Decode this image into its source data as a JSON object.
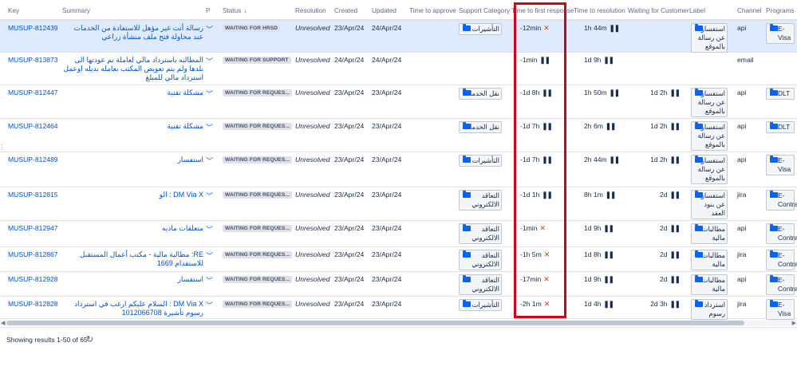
{
  "headers": {
    "key": "Key",
    "summary": "Summary",
    "p": "P",
    "status": "Status",
    "status_sort": "↓",
    "resolution": "Resolution",
    "created": "Created",
    "updated": "Updated",
    "time_to_approve": "Time to approve",
    "support_category": "Support Category",
    "time_to_first_response": "Time to first response",
    "time_to_resolution": "Time to resolution",
    "waiting_for_customer": "Waiting for Customer",
    "label": "Label",
    "channel": "Channel",
    "programs": "Programs"
  },
  "rows": [
    {
      "key": "MUSUP-812439",
      "summary": "رسالة أنت غير مؤهل للاستفادة من الخدمات عند محاولة فتح ملف منشأة زراعي",
      "status": "WAITING FOR HRSD",
      "resolution": "Unresolved",
      "created": "23/Apr/24",
      "updated": "24/Apr/24",
      "category": "التأشيرات",
      "ttfr": "-12min",
      "ttfr_breached": true,
      "ttr": "1h 44m",
      "ttr_paused": true,
      "wfc": "",
      "wfc_paused": false,
      "label": "استفسار عن رسالة بالموقع",
      "channel": "api",
      "program": "E-Visa"
    },
    {
      "key": "MUSUP-813873",
      "summary": "المطالبه باسترداد مالي لعاملة تم عودتها الى بلدها ولم يتم تعويض المكتب بعامله بديله اوعمل استرداد مالي للمبلغ",
      "status": "WAITING FOR SUPPORT",
      "resolution": "Unresolved",
      "created": "24/Apr/24",
      "updated": "24/Apr/24",
      "category": "",
      "ttfr": "-1min",
      "ttfr_breached": false,
      "ttr": "1d 9h",
      "ttr_paused": true,
      "wfc": "",
      "wfc_paused": false,
      "label": "",
      "channel": "email",
      "program": ""
    },
    {
      "key": "MUSUP-812447",
      "summary": "مشكلة تقنية",
      "status": "WAITING FOR REQUES...",
      "resolution": "Unresolved",
      "created": "23/Apr/24",
      "updated": "23/Apr/24",
      "category": "نقل الخدمات",
      "ttfr": "-1d 8h",
      "ttfr_breached": false,
      "ttr": "1h 50m",
      "ttr_paused": true,
      "wfc": "1d 2h",
      "wfc_paused": true,
      "label": "استفسار عن رسالة بالموقع",
      "channel": "api",
      "program": "DLT"
    },
    {
      "key": "MUSUP-812464",
      "summary": "مشكلة تقنية",
      "status": "WAITING FOR REQUES...",
      "resolution": "Unresolved",
      "created": "23/Apr/24",
      "updated": "23/Apr/24",
      "category": "نقل الخدمات",
      "ttfr": "-1d 7h",
      "ttfr_breached": false,
      "ttr": "2h 6m",
      "ttr_paused": true,
      "wfc": "1d 2h",
      "wfc_paused": true,
      "label": "استفسار عن رسالة بالموقع",
      "channel": "api",
      "program": "DLT"
    },
    {
      "key": "MUSUP-812489",
      "summary": "استفسار",
      "status": "WAITING FOR REQUES...",
      "resolution": "Unresolved",
      "created": "23/Apr/24",
      "updated": "23/Apr/24",
      "category": "التأشيرات",
      "ttfr": "-1d 7h",
      "ttfr_breached": false,
      "ttr": "2h 44m",
      "ttr_paused": true,
      "wfc": "1d 2h",
      "wfc_paused": true,
      "label": "استفسار عن رسالة بالموقع",
      "channel": "api",
      "program": "E-Visa"
    },
    {
      "key": "MUSUP-812815",
      "summary": "DM Via X : الو",
      "status": "WAITING FOR REQUES...",
      "resolution": "Unresolved",
      "created": "23/Apr/24",
      "updated": "23/Apr/24",
      "category": "التعاقد الالكتروني",
      "ttfr": "-1d 1h",
      "ttfr_breached": false,
      "ttr": "8h 1m",
      "ttr_paused": true,
      "wfc": "2d",
      "wfc_paused": true,
      "label": "استفسار عن بنود العقد",
      "channel": "jira",
      "program": "E-Contract"
    },
    {
      "key": "MUSUP-812947",
      "summary": "متعلقات ماديه",
      "status": "WAITING FOR REQUES...",
      "resolution": "Unresolved",
      "created": "23/Apr/24",
      "updated": "23/Apr/24",
      "category": "التعاقد الالكتروني",
      "ttfr": "-1min",
      "ttfr_breached": true,
      "ttr": "1d 9h",
      "ttr_paused": true,
      "wfc": "2d",
      "wfc_paused": true,
      "label": "مطالبات مالية",
      "channel": "api",
      "program": "E-Contract"
    },
    {
      "key": "MUSUP-812867",
      "summary": "RE: مطالبة مالية - مكتب أعمال المستقبل للاستقدام 1669",
      "status": "WAITING FOR REQUES...",
      "resolution": "Unresolved",
      "created": "23/Apr/24",
      "updated": "23/Apr/24",
      "category": "التعاقد الالكتروني",
      "ttfr": "-1h 5m",
      "ttfr_breached": true,
      "ttr": "1d 8h",
      "ttr_paused": true,
      "wfc": "2d",
      "wfc_paused": true,
      "label": "مطالبات مالية",
      "channel": "jira",
      "program": "E-Contract"
    },
    {
      "key": "MUSUP-812928",
      "summary": "استفسار",
      "status": "WAITING FOR REQUES...",
      "resolution": "Unresolved",
      "created": "23/Apr/24",
      "updated": "23/Apr/24",
      "category": "التعاقد الالكتروني",
      "ttfr": "-17min",
      "ttfr_breached": true,
      "ttr": "1d 9h",
      "ttr_paused": true,
      "wfc": "2d",
      "wfc_paused": true,
      "label": "مطالبات مالية",
      "channel": "api",
      "program": "E-Contract"
    },
    {
      "key": "MUSUP-812828",
      "summary": "DM Via X : السلام عليكم ارغب في استرداد رسوم تأشيرة 1012066708",
      "status": "WAITING FOR REQUES...",
      "resolution": "Unresolved",
      "created": "23/Apr/24",
      "updated": "23/Apr/24",
      "category": "التأشيرات",
      "ttfr": "-2h 1m",
      "ttfr_breached": true,
      "ttr": "1d 4h",
      "ttr_paused": true,
      "wfc": "2d 3h",
      "wfc_paused": true,
      "label": "استرداد رسوم",
      "channel": "jira",
      "program": "E-Visa"
    }
  ],
  "icons": {
    "pause": "❚❚",
    "breached": "✕",
    "chevron": "﹀",
    "refresh": "↻",
    "folder": "folder-icon"
  },
  "colors": {
    "link": "#0052cc",
    "selected_row": "#deebff",
    "highlight_box": "#d0021b",
    "breach": "#de350b"
  },
  "footer": {
    "text": "Showing results 1-50 of 65",
    "refresh": "↻"
  }
}
